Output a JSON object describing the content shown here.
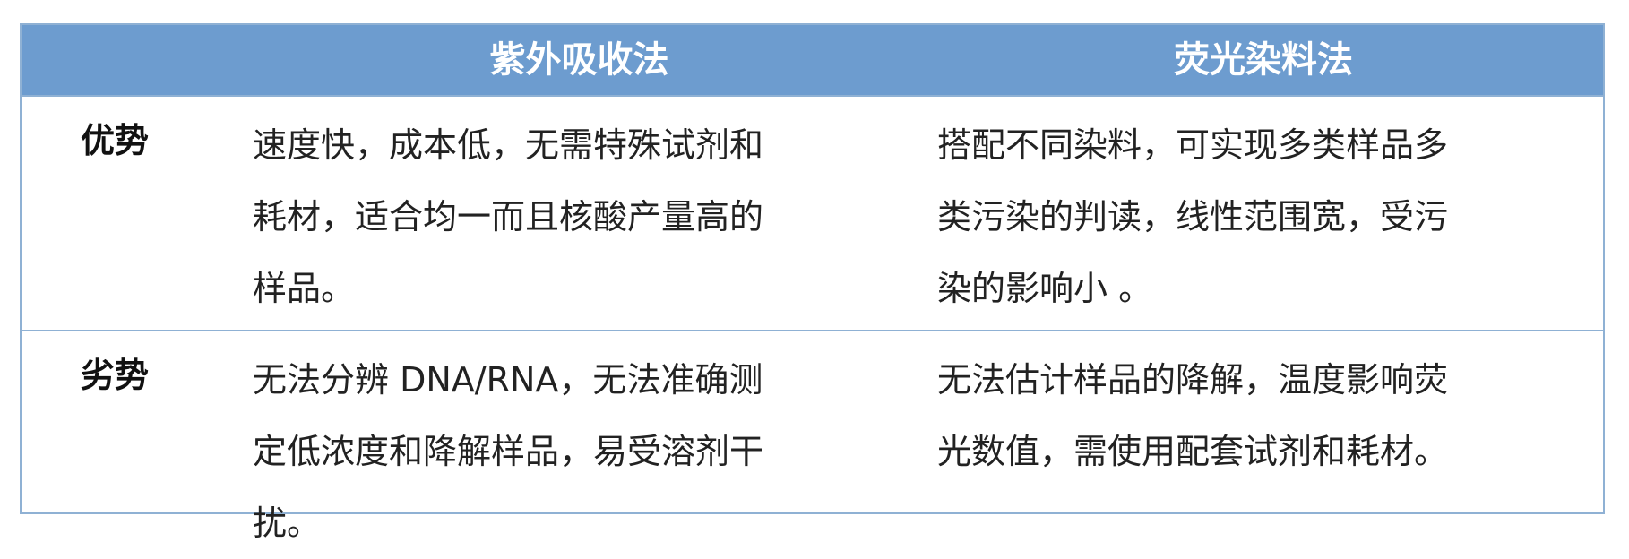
{
  "table": {
    "headers": [
      "",
      "紫外吸收法",
      "荧光染料法"
    ],
    "rows": [
      {
        "label": "优势",
        "col1_text": "速度快，成本低，无需特殊试剂和\n耗材，适合均一而且核酸产量高的\n样品。",
        "col2_text": "搭配不同染料，可实现多类样品多\n类污染的判读，线性范围宽，受污\n染的影响小 。"
      },
      {
        "label": "劣势",
        "col1_text": "无法分辨 DNA/RNA，无法准确测\n定低浓度和降解样品，易受溶剂干\n扰。",
        "col2_text": "无法估计样品的降解，温度影响荧\n光数值，需使用配套试剂和耗材。"
      }
    ]
  },
  "colors": {
    "header_bg": "#6d9ccf",
    "border": "#8fb1d4",
    "header_text": "#ffffff"
  }
}
